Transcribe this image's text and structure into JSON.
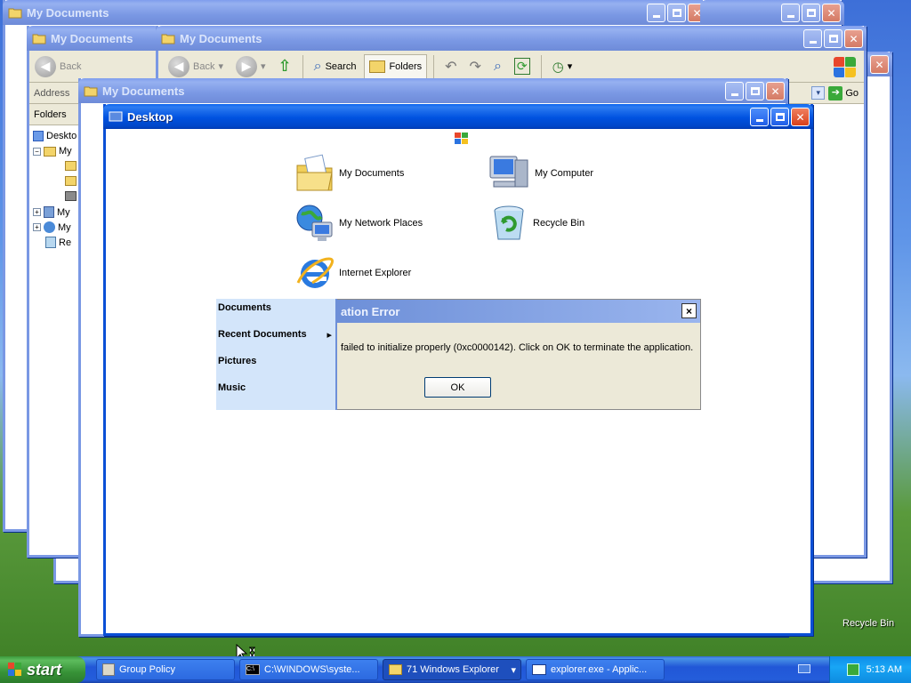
{
  "windows": {
    "w1": {
      "title": "My Documents"
    },
    "w2": {
      "title": "My Documents",
      "address_label": "Address",
      "folders_label": "Folders",
      "tree": [
        "Deskto",
        "My",
        "My",
        "My",
        "Re"
      ]
    },
    "w3": {
      "title": "My Documents",
      "toolbar": {
        "back": "Back",
        "search": "Search",
        "folders": "Folders",
        "go": "Go"
      }
    },
    "w4": {
      "title": "My Documents"
    },
    "desktop": {
      "title": "Desktop"
    }
  },
  "desktop_icons": [
    {
      "label": "My Documents",
      "icon": "folder-documents-icon"
    },
    {
      "label": "My Computer",
      "icon": "computer-icon"
    },
    {
      "label": "My Network Places",
      "icon": "network-places-icon"
    },
    {
      "label": "Recycle Bin",
      "icon": "recycle-bin-icon"
    },
    {
      "label": "Internet Explorer",
      "icon": "internet-explorer-icon"
    }
  ],
  "dialog": {
    "title": "ation Error",
    "message": "failed to initialize properly (0xc0000142). Click on OK to terminate the application.",
    "ok": "OK",
    "close": "×"
  },
  "start_menu": {
    "items": [
      "Documents",
      "Recent Documents",
      "Pictures",
      "Music"
    ],
    "submenu_arrow": "▸"
  },
  "wallpaper_icon": {
    "label": "Recycle Bin"
  },
  "taskbar": {
    "start": "start",
    "tasks": [
      {
        "label": "Group Policy"
      },
      {
        "label": "C:\\WINDOWS\\syste..."
      },
      {
        "label": "71 Windows Explorer",
        "arrow": "▾"
      },
      {
        "label": "explorer.exe - Applic..."
      }
    ],
    "clock": "5:13 AM"
  },
  "colors": {
    "titlebar_active": "#0052e0",
    "titlebar_inactive": "#7a98e4",
    "start_green": "#379237",
    "taskbar_blue": "#245ddb"
  }
}
